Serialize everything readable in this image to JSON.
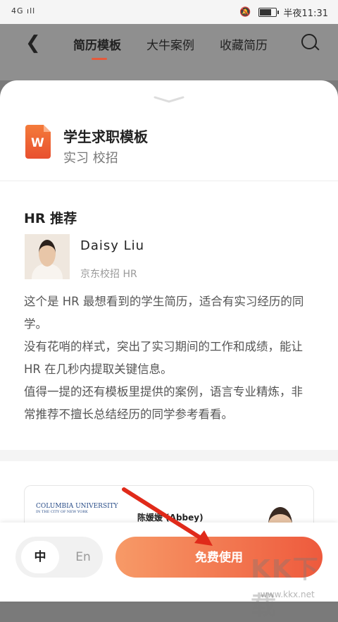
{
  "status_bar": {
    "signal": "4G ıll",
    "time": "半夜11:31"
  },
  "nav": {
    "tabs": [
      "简历模板",
      "大牛案例",
      "收藏简历"
    ],
    "active_tab": 0
  },
  "template": {
    "title": "学生求职模板",
    "tags": "实习 校招"
  },
  "hr": {
    "heading": "HR 推荐",
    "name": "Daisy  Liu",
    "role": "京东校招  HR",
    "description": [
      "这个是 HR 最想看到的学生简历，适合有实习经历的同学。",
      "没有花哨的样式，突出了实习期间的工作和成绩，能让 HR 在几秒内提取关键信息。",
      "值得一提的还有模板里提供的案例，语言专业精炼，非常推荐不擅长总结经历的同学参考看看。"
    ]
  },
  "preview": {
    "university": "COLUMBIA UNIVERSITY",
    "university_sub": "IN THE CITY OF NEW YORK",
    "name": "陈媛媛 (Abbey)"
  },
  "bottom": {
    "lang_zh": "中",
    "lang_en": "En",
    "cta": "免费使用"
  },
  "watermark": {
    "text": "KK下载",
    "url": "www.kkx.net"
  },
  "colors": {
    "accent": "#e55a3c",
    "cta_start": "#f79a67",
    "cta_end": "#ee5a3d"
  }
}
